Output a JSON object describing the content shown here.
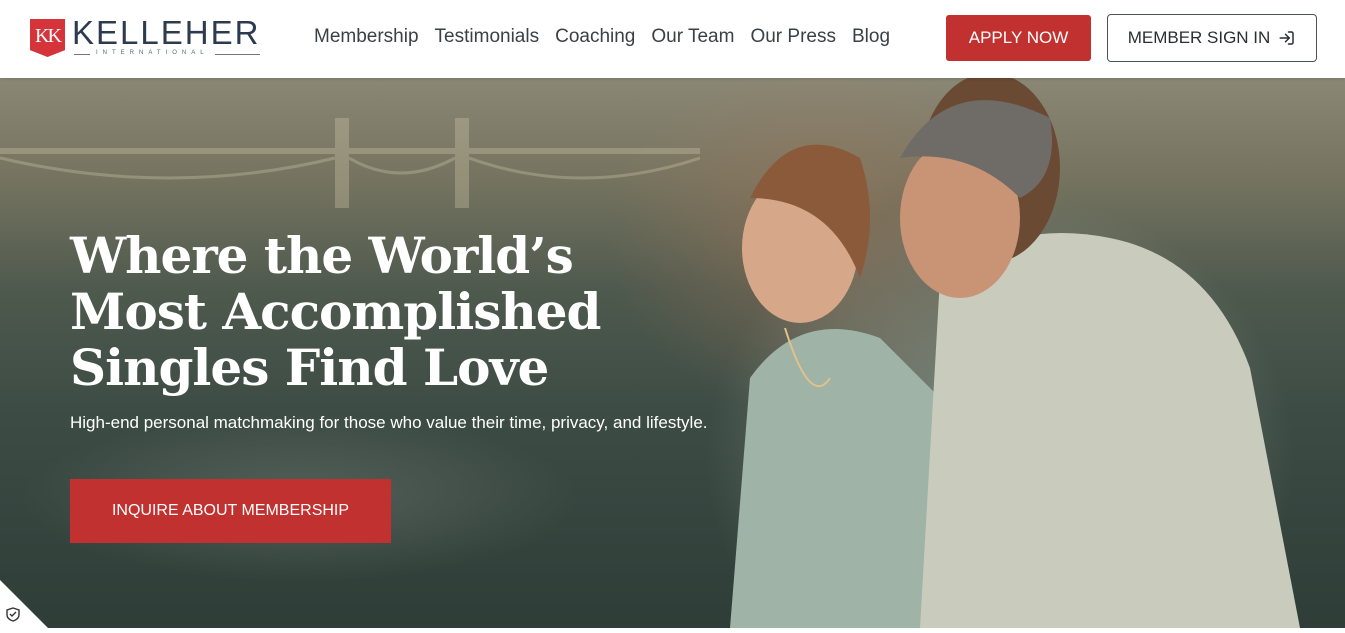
{
  "brand": {
    "name": "KELLEHER",
    "sub": "INTERNATIONAL",
    "badge_letters": "KK",
    "accent_color": "#c0312f"
  },
  "nav": {
    "items": [
      "Membership",
      "Testimonials",
      "Coaching",
      "Our Team",
      "Our Press",
      "Blog"
    ]
  },
  "header_actions": {
    "apply_label": "APPLY NOW",
    "signin_label": "MEMBER SIGN IN",
    "signin_icon": "sign-in-arrow-icon"
  },
  "hero": {
    "title_line1": "Where the World’s",
    "title_line2": "Most Accomplished",
    "title_line3": "Singles Find Love",
    "subtitle": "High-end personal matchmaking for those who value their time, privacy, and lifestyle.",
    "cta_label": "INQUIRE ABOUT MEMBERSHIP",
    "image_subject": "couple embracing on a boat near a bridge"
  },
  "privacy_badge": {
    "icon": "shield-check-icon"
  }
}
